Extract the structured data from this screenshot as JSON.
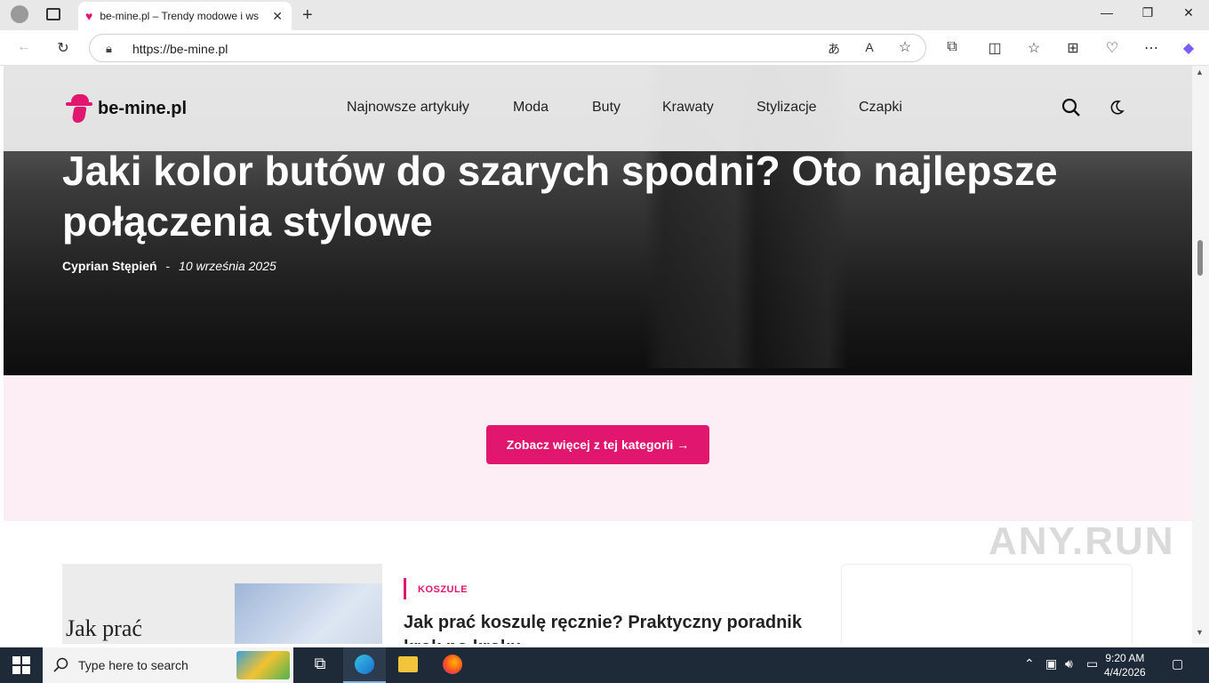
{
  "browser": {
    "tab_title": "be-mine.pl – Trendy modowe i ws",
    "url": "https://be-mine.pl",
    "new_tab": "+",
    "tab_close": "✕"
  },
  "site": {
    "logo_text": "be-mine.pl",
    "nav": [
      "Najnowsze artykuły",
      "Moda",
      "Buty",
      "Krawaty",
      "Stylizacje",
      "Czapki"
    ],
    "hero": {
      "title": "Jaki kolor butów do szarych spodni? Oto najlepsze połączenia stylowe",
      "author": "Cyprian Stępień",
      "separator": "-",
      "date": "10 września 2025"
    },
    "cta": "Zobacz więcej z tej kategorii  →",
    "card": {
      "thumb_text": "Jak prać",
      "category": "KOSZULE",
      "title": "Jak prać koszulę ręcznie? Praktyczny poradnik krok po kroku"
    },
    "accent_color": "#e0166f"
  },
  "taskbar": {
    "search_placeholder": "Type here to search",
    "time": "9:20 AM",
    "date": "4/4/2026"
  },
  "watermark": "ANY.RUN"
}
